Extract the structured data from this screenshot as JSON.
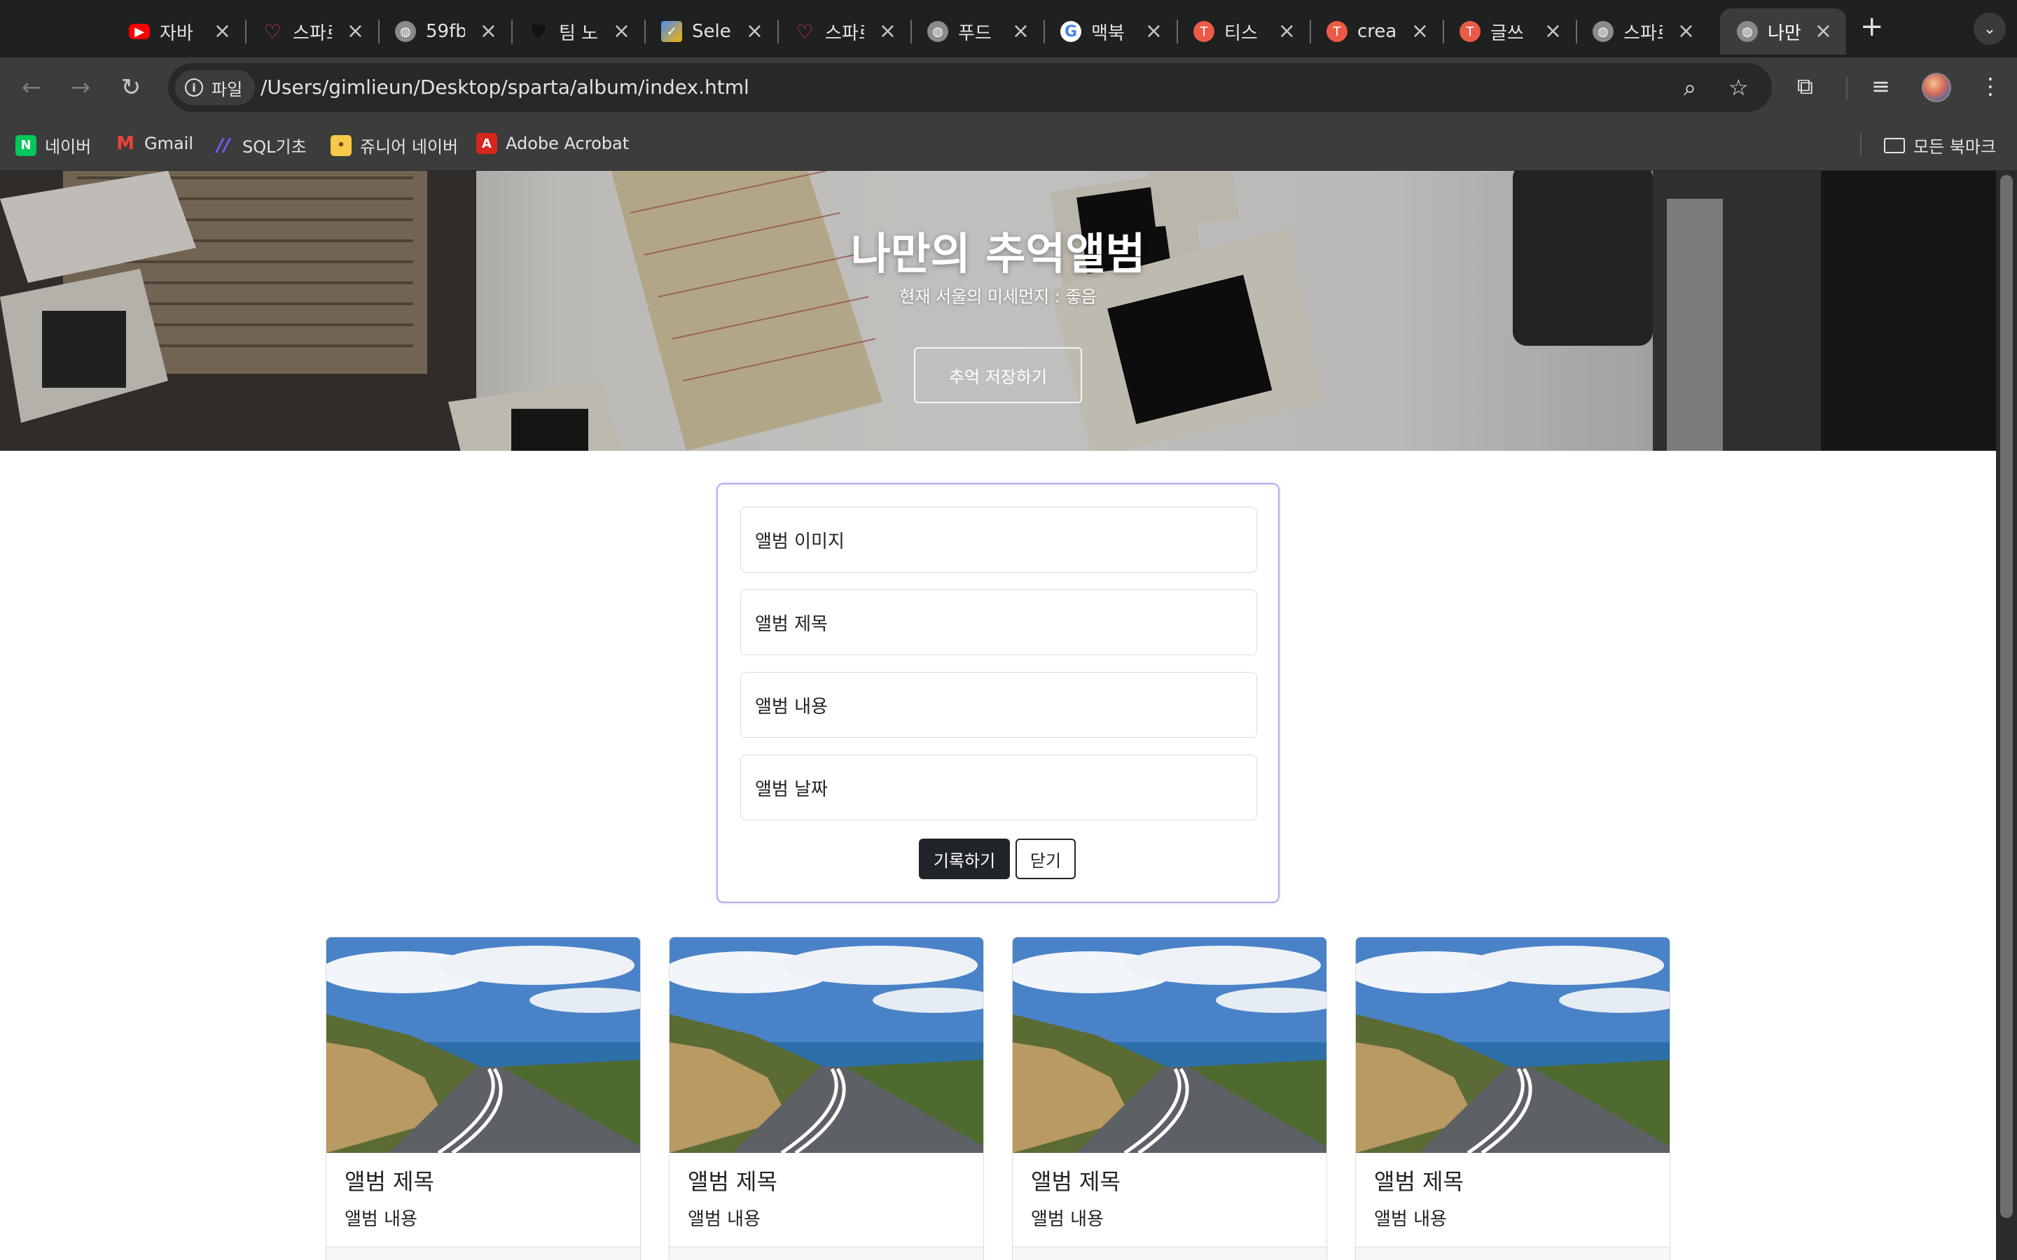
{
  "browser": {
    "tabs": [
      {
        "title": "자바",
        "icon": "youtube-icon",
        "color": "#ff0000"
      },
      {
        "title": "스파르",
        "icon": "sparta-heart-icon",
        "color": "#e8344e"
      },
      {
        "title": "59fb",
        "icon": "globe-icon",
        "color": "#8a8a8a"
      },
      {
        "title": "팀 노",
        "icon": "black-heart-icon",
        "color": "#111111"
      },
      {
        "title": "Sele",
        "icon": "selenium-icon",
        "color": "#4b8bf5"
      },
      {
        "title": "스파르",
        "icon": "sparta-heart-icon",
        "color": "#e8344e"
      },
      {
        "title": "푸드",
        "icon": "globe-icon",
        "color": "#8a8a8a"
      },
      {
        "title": "맥북",
        "icon": "google-icon",
        "color": "#ffffff"
      },
      {
        "title": "티스",
        "icon": "tistory-icon",
        "color": "#eb5a46"
      },
      {
        "title": "crea",
        "icon": "tistory-icon",
        "color": "#eb5a46"
      },
      {
        "title": "글쓰",
        "icon": "tistory-icon",
        "color": "#eb5a46"
      },
      {
        "title": "스파르",
        "icon": "globe-icon",
        "color": "#8a8a8a"
      },
      {
        "title": "나만",
        "icon": "globe-icon",
        "color": "#8a8a8a",
        "active": true
      }
    ],
    "address": {
      "chip_label": "파일",
      "url": "/Users/gimlieun/Desktop/sparta/album/index.html"
    },
    "bookmarks": [
      {
        "label": "네이버",
        "icon": "naver-icon",
        "color": "#03c75a",
        "glyph": "N"
      },
      {
        "label": "Gmail",
        "icon": "gmail-icon",
        "color": "#ea4335",
        "glyph": "M"
      },
      {
        "label": "SQL기초",
        "icon": "sql-slash-icon",
        "color": "#6c63ff",
        "glyph": "//"
      },
      {
        "label": "쥬니어 네이버",
        "icon": "junior-naver-icon",
        "color": "#f7c948",
        "glyph": "•"
      },
      {
        "label": "Adobe Acrobat",
        "icon": "acrobat-icon",
        "color": "#d7261c",
        "glyph": "A"
      }
    ],
    "all_bookmarks_label": "모든 북마크"
  },
  "hero": {
    "title": "나만의 추억앨범",
    "subtitle": "현재 서울의 미세먼지 : 좋음",
    "button_label": "추억 저장하기"
  },
  "form": {
    "image_placeholder": "앨범 이미지",
    "title_placeholder": "앨범 제목",
    "content_placeholder": "앨범 내용",
    "date_placeholder": "앨범 날짜",
    "submit_label": "기록하기",
    "close_label": "닫기"
  },
  "cards": [
    {
      "title": "앨범 제목",
      "content": "앨범 내용"
    },
    {
      "title": "앨범 제목",
      "content": "앨범 내용"
    },
    {
      "title": "앨범 제목",
      "content": "앨범 내용"
    },
    {
      "title": "앨범 제목",
      "content": "앨범 내용"
    }
  ]
}
